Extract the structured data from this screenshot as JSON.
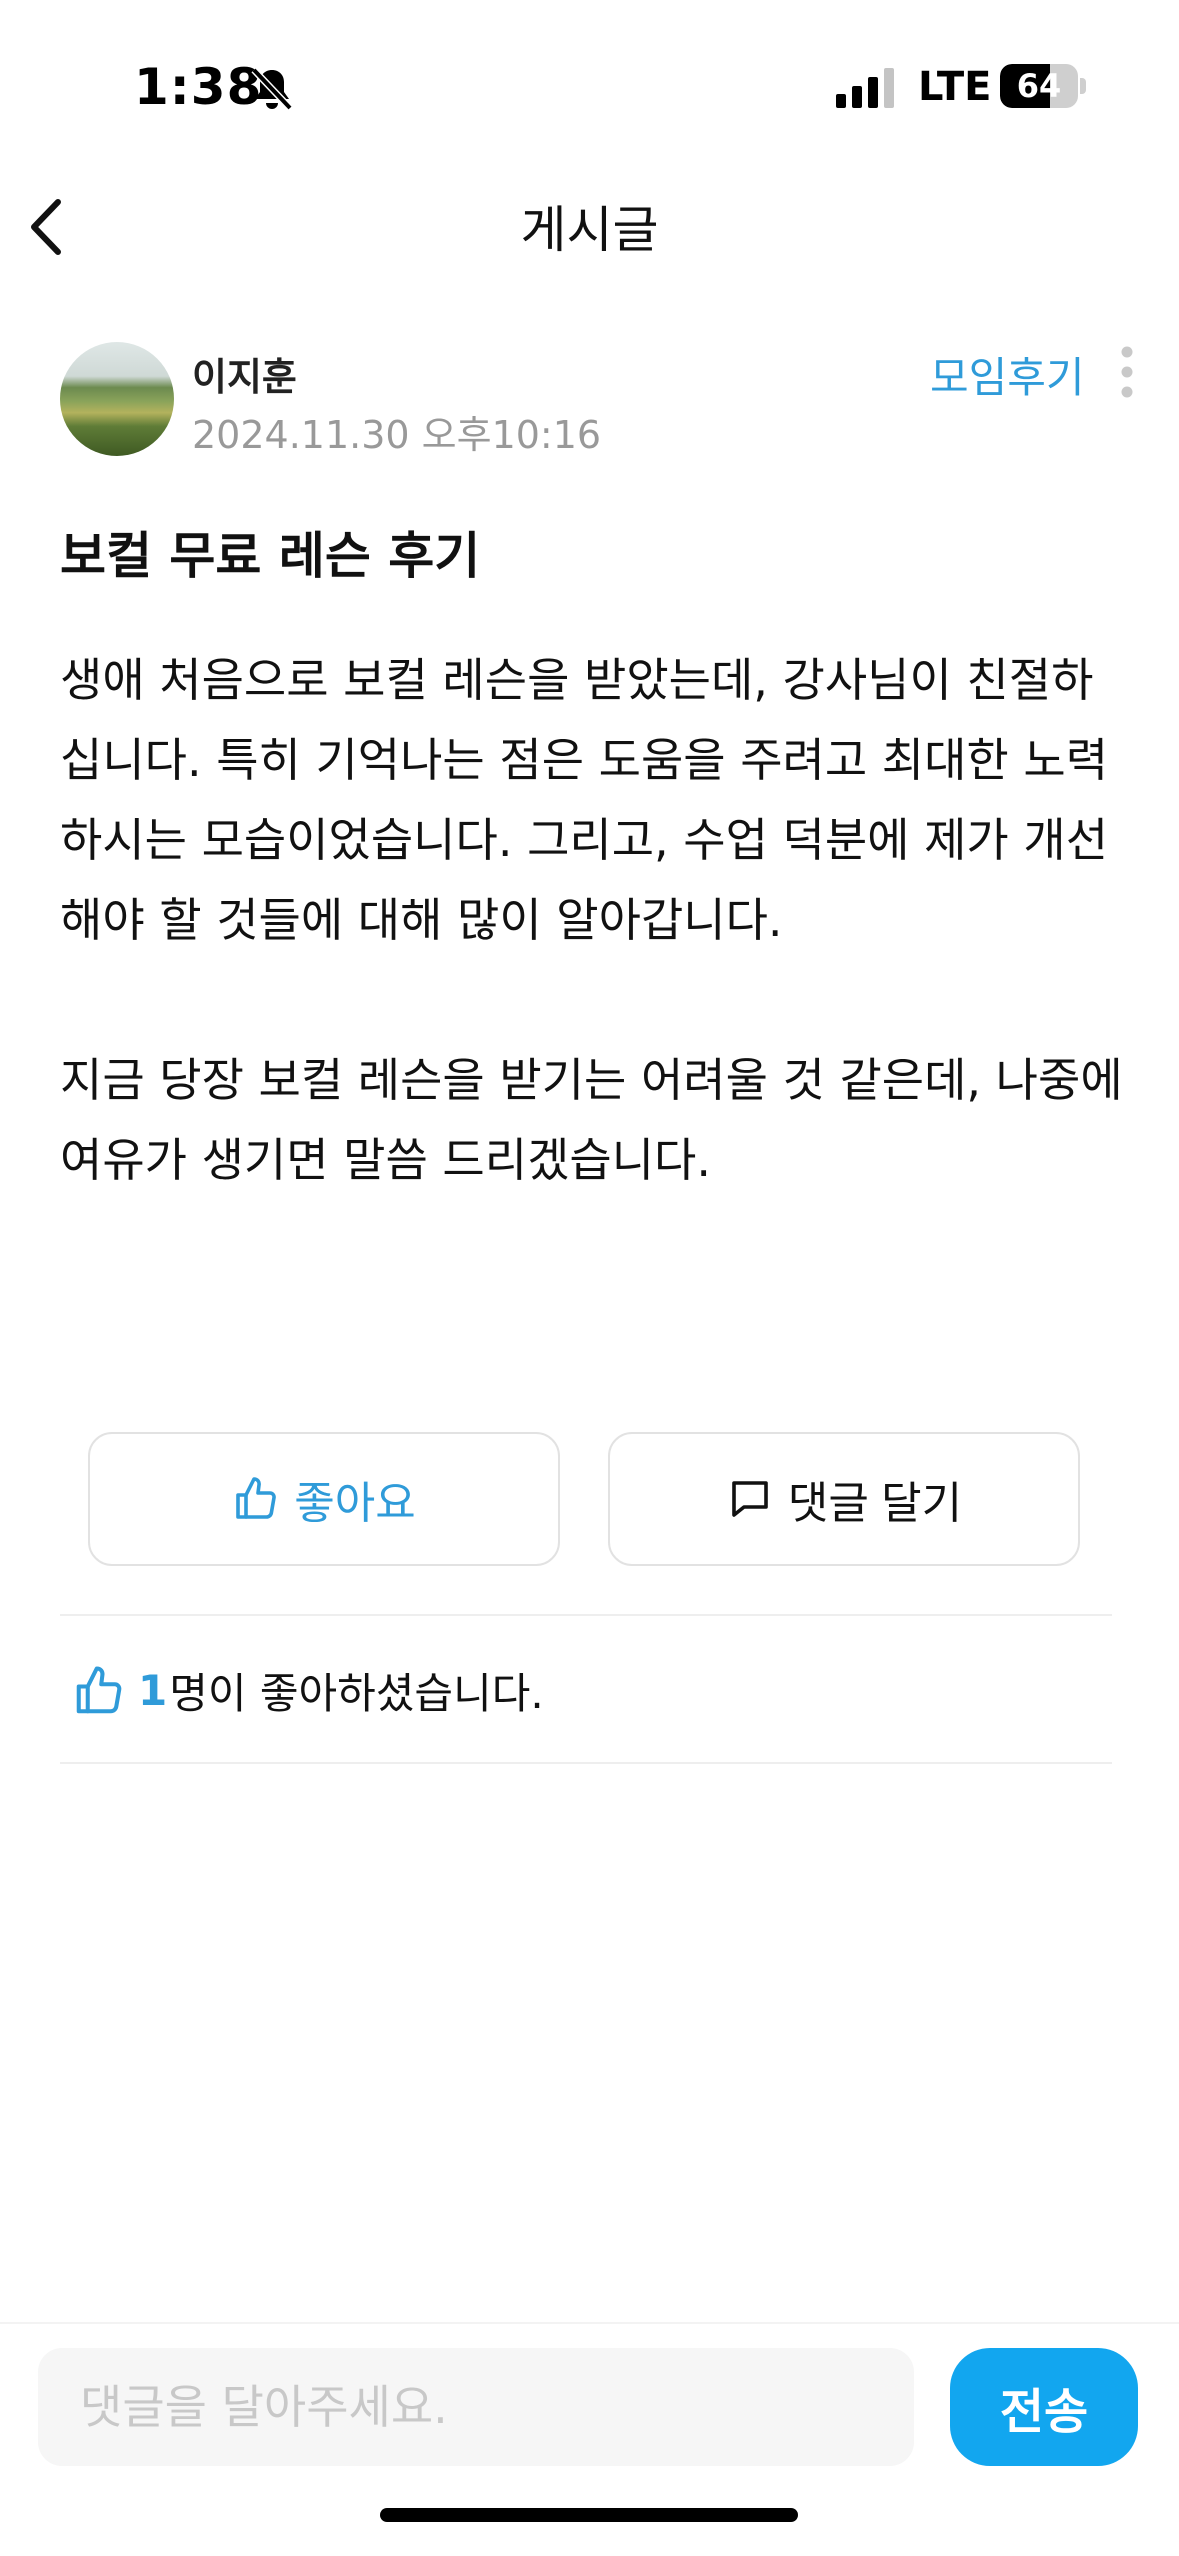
{
  "status_bar": {
    "time": "1:38",
    "network": "LTE",
    "battery_level": "64",
    "battery_fraction": 0.64
  },
  "nav": {
    "title": "게시글",
    "back_icon": "chevron-left-icon"
  },
  "post": {
    "author": "이지훈",
    "date": "2024.11.30 오후10:16",
    "category": "모임후기",
    "title": "보컬 무료 레슨 후기",
    "body": " 생애 처음으로 보컬 레슨을 받았는데, 강사님이 친절하십니다. 특히 기억나는 점은 도움을 주려고 최대한 노력하시는 모습이었습니다. 그리고, 수업 덕분에 제가 개선해야 할 것들에 대해 많이 알아갑니다.\n\n 지금 당장 보컬 레슨을 받기는 어려울 것 같은데, 나중에 여유가 생기면 말씀 드리겠습니다."
  },
  "actions": {
    "like_label": "좋아요",
    "comment_label": "댓글 달기"
  },
  "likes": {
    "count": "1",
    "suffix": "명이 좋아하셨습니다."
  },
  "comment_bar": {
    "placeholder": "댓글을 달아주세요.",
    "send_label": "전송"
  },
  "colors": {
    "accent": "#2f9bd9",
    "send_button": "#12a6ef",
    "muted_text": "#999999"
  }
}
